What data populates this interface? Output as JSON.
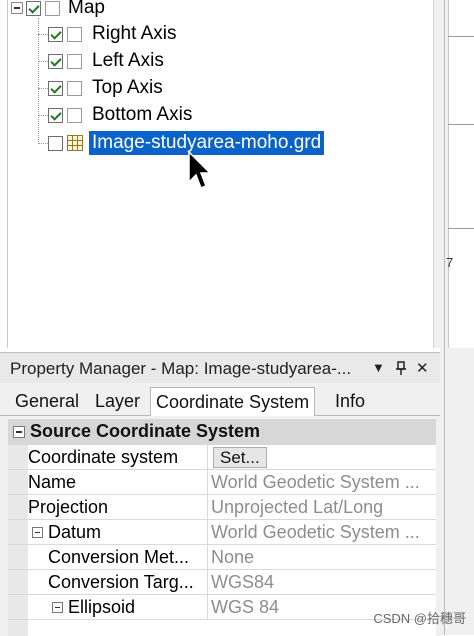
{
  "tree": {
    "root": {
      "label": "Map",
      "checked": true
    },
    "items": [
      {
        "label": "Right Axis",
        "checked": true
      },
      {
        "label": "Left Axis",
        "checked": true
      },
      {
        "label": "Top Axis",
        "checked": true
      },
      {
        "label": "Bottom Axis",
        "checked": true
      },
      {
        "label": "Image-studyarea-moho.grd",
        "checked": false,
        "selected": true
      }
    ]
  },
  "right_strip": {
    "marker": "7"
  },
  "property_manager": {
    "title": "Property Manager - Map: Image-studyarea-...",
    "dropdown_icon": "▼",
    "pin_icon": "pin-icon",
    "close_icon": "✕",
    "tabs": [
      "General",
      "Layer",
      "Coordinate System",
      "Info"
    ],
    "active_tab": "Coordinate System",
    "section": "Source Coordinate System",
    "rows": [
      {
        "name": "Coordinate system",
        "value": "",
        "button": "Set..."
      },
      {
        "name": "Name",
        "value": "World Geodetic System ..."
      },
      {
        "name": "Projection",
        "value": "Unprojected Lat/Long"
      },
      {
        "name": "Datum",
        "value": "World Geodetic System ..."
      },
      {
        "name": "Conversion Met...",
        "value": "None"
      },
      {
        "name": "Conversion Targ...",
        "value": "WGS84"
      },
      {
        "name": "Ellipsoid",
        "value": "WGS 84"
      }
    ]
  },
  "watermark": "CSDN @拾穗哥"
}
